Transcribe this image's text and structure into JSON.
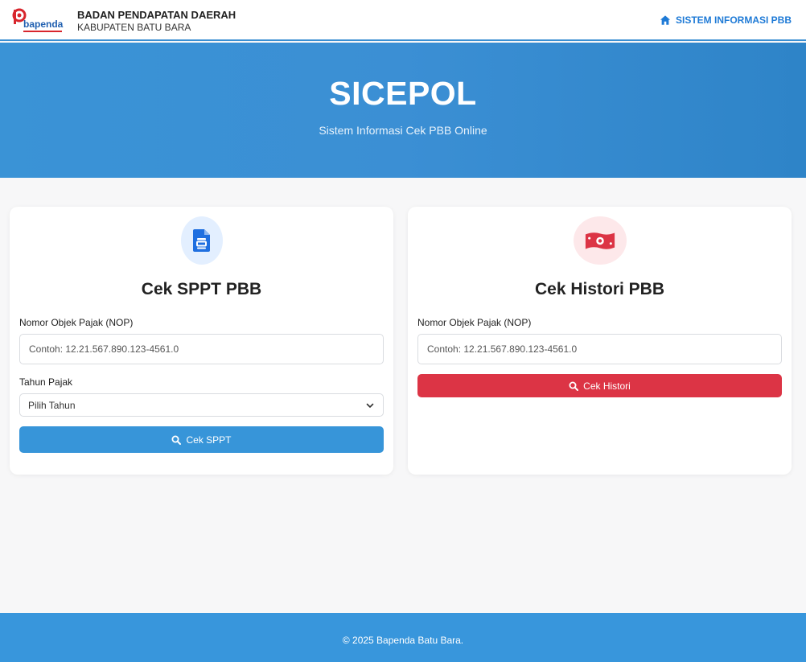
{
  "header": {
    "logo_text": "bapenda",
    "brand_name": "BADAN PENDAPATAN DAERAH",
    "brand_sub": "KABUPATEN BATU BARA",
    "nav_link": "SISTEM INFORMASI PBB"
  },
  "hero": {
    "title": "SICEPOL",
    "subtitle": "Sistem Informasi Cek PBB Online"
  },
  "sppt_card": {
    "title": "Cek SPPT PBB",
    "nop_label": "Nomor Objek Pajak (NOP)",
    "nop_placeholder": "Contoh: 12.21.567.890.123-4561.0",
    "year_label": "Tahun Pajak",
    "year_selected": "Pilih Tahun",
    "button_label": "Cek SPPT"
  },
  "histori_card": {
    "title": "Cek Histori PBB",
    "nop_label": "Nomor Objek Pajak (NOP)",
    "nop_placeholder": "Contoh: 12.21.567.890.123-4561.0",
    "button_label": "Cek Histori"
  },
  "footer": {
    "text": "© 2025 Bapenda Batu Bara."
  },
  "colors": {
    "primary_blue": "#3795d9",
    "danger_red": "#dc3445",
    "nav_link_blue": "#1e7ad6"
  },
  "icons": {
    "nav": "home-icon",
    "sppt": "document-icon",
    "histori": "money-bill-icon",
    "search": "search-icon",
    "select": "chevron-down-icon"
  }
}
